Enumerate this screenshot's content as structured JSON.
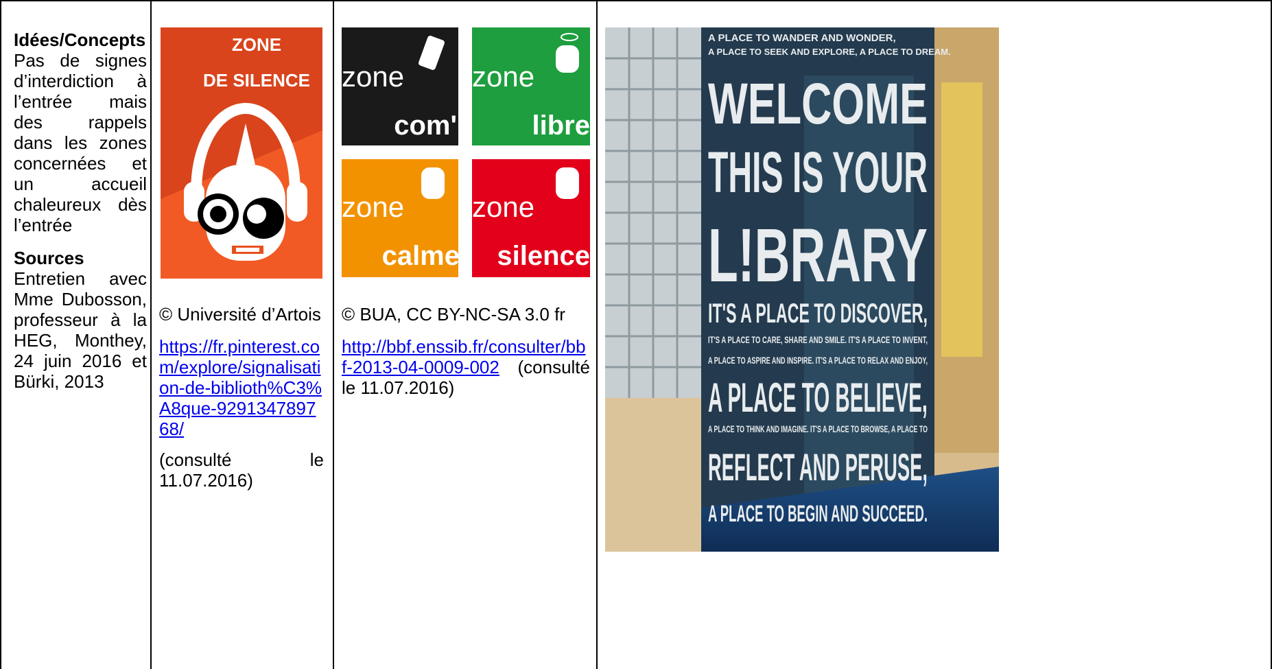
{
  "col1": {
    "heading_ideas": "Idées/Concepts",
    "ideas_text": "Pas de signes d’interdiction à l’entrée mais des rappels dans les zones concernées et un accueil chaleureux dès l’entrée",
    "heading_sources": "Sources",
    "sources_text": "Entretien avec Mme Dubosson, professeur à la HEG, Monthey, 24 juin 2016 et Bürki, 2013"
  },
  "col2": {
    "poster": {
      "line1": "ZONE",
      "line2": "DE SILENCE",
      "bg_color": "#e8501e"
    },
    "credit": "© Université d’Artois",
    "url": "https://fr.pinterest.com/explore/signalisation-de-biblioth%C3%A8que-929134789768/",
    "consulted": "(consulté le 11.07.2016)"
  },
  "col3": {
    "tiles": [
      {
        "word": "zone",
        "name": "com'",
        "color": "#1a1a1a"
      },
      {
        "word": "zone",
        "name": "libre",
        "color": "#1e9e3e"
      },
      {
        "word": "zone",
        "name": "calme",
        "color": "#f39200"
      },
      {
        "word": "zone",
        "name": "silence",
        "color": "#e2001a"
      }
    ],
    "credit": "© BUA, CC BY-NC-SA 3.0 fr",
    "url": "http://bbf.enssib.fr/consulter/bbf-2013-04-0009-002",
    "consulted_suffix": " (consulté le 11.07.2016)"
  },
  "col4": {
    "photo": {
      "top_lines": [
        "A PLACE TO WANDER AND WONDER,",
        "A PLACE TO SEEK AND EXPLORE, A PLACE TO DREAM."
      ],
      "big_lines": [
        "WELCOME",
        "THIS IS YOUR",
        "L!BRARY"
      ],
      "mid_line": "IT'S A PLACE TO DISCOVER,",
      "small_lines": [
        "IT'S A PLACE TO CARE, SHARE AND SMILE. IT'S A PLACE TO INVENT,",
        "A PLACE TO ASPIRE AND INSPIRE. IT'S A PLACE TO RELAX AND ENJOY,"
      ],
      "believe": "A PLACE TO BELIEVE,",
      "small_lines2": [
        "A PLACE TO THINK AND IMAGINE. IT'S A PLACE TO BROWSE, A PLACE TO"
      ],
      "reflect": "REFLECT AND PERUSE,",
      "last": "A PLACE TO BEGIN AND SUCCEED."
    }
  }
}
